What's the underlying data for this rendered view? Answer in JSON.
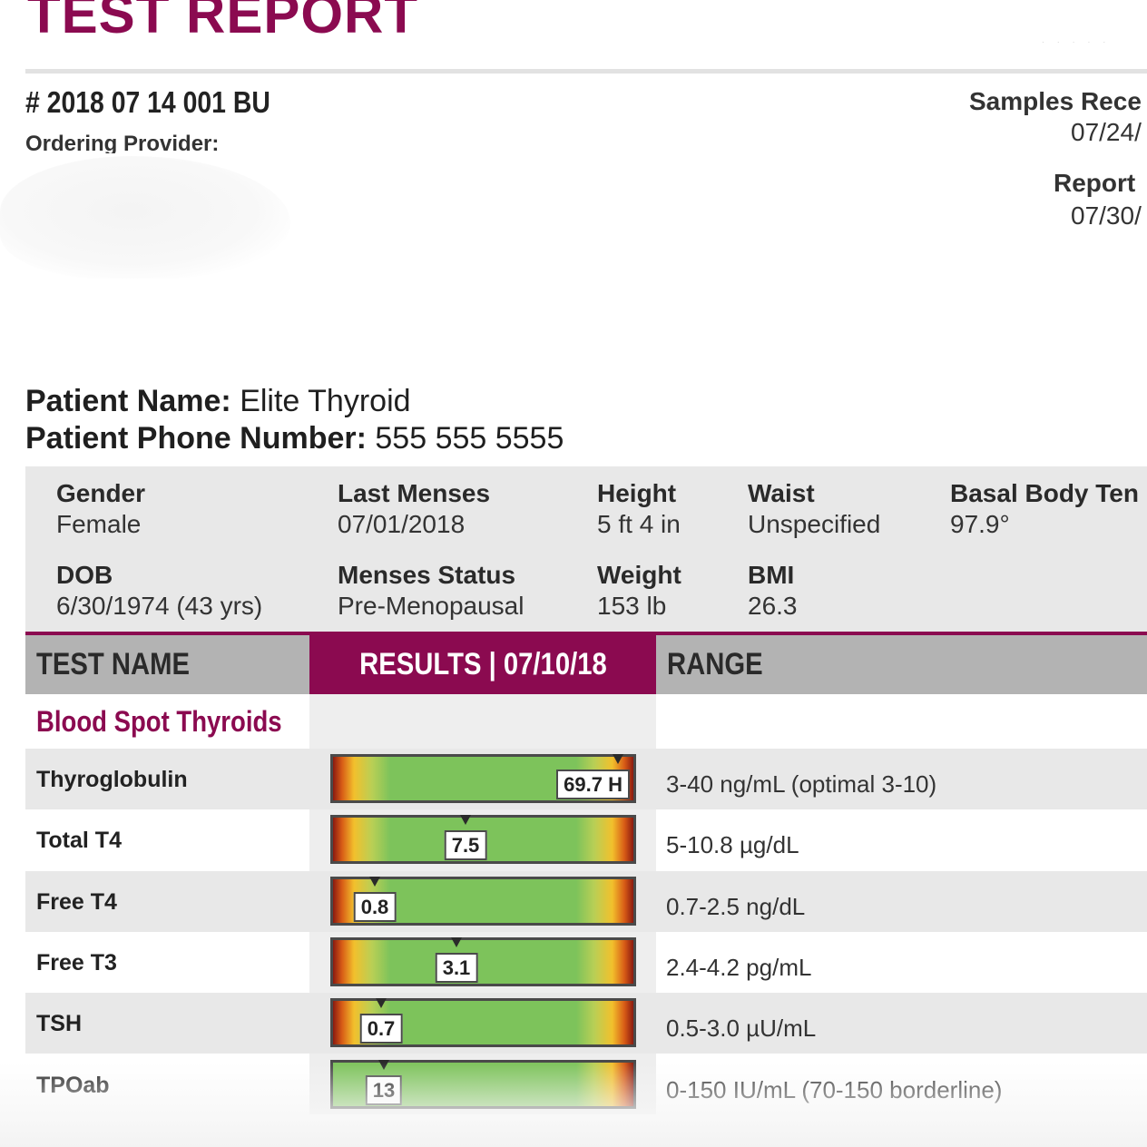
{
  "report": {
    "title": "TEST REPORT",
    "number": "# 2018 07 14 001 BU",
    "ordering_provider_label": "Ordering Provider:",
    "samples_received_label": "Samples Rece",
    "samples_received_value": "07/24/",
    "report_date_label": "Report",
    "report_date_value": "07/30/"
  },
  "patient": {
    "name_label": "Patient Name:",
    "name": "Elite Thyroid",
    "phone_label": "Patient Phone Number:",
    "phone": "555 555 5555"
  },
  "demographics": [
    {
      "label": "Gender",
      "value": "Female"
    },
    {
      "label": "Last Menses",
      "value": "07/01/2018"
    },
    {
      "label": "Height",
      "value": "5 ft 4 in"
    },
    {
      "label": "Waist",
      "value": "Unspecified"
    },
    {
      "label": "Basal Body Ten",
      "value": "97.9°"
    },
    {
      "label": "DOB",
      "value": "6/30/1974 (43 yrs)"
    },
    {
      "label": "Menses Status",
      "value": "Pre-Menopausal"
    },
    {
      "label": "Weight",
      "value": "153 lb"
    },
    {
      "label": "BMI",
      "value": "26.3"
    }
  ],
  "table": {
    "headers": {
      "name": "TEST NAME",
      "results": "RESULTS | 07/10/18",
      "range": "RANGE"
    },
    "section": "Blood Spot Thyroids",
    "rows": [
      {
        "name": "Thyroglobulin",
        "value": "69.7 H",
        "range": "3-40 ng/mL (optimal 3-10)",
        "marker_fraction": 0.95,
        "flag": "high"
      },
      {
        "name": "Total T4",
        "value": "7.5",
        "range": "5-10.8 µg/dL",
        "marker_fraction": 0.44,
        "flag": "normal"
      },
      {
        "name": "Free T4",
        "value": "0.8",
        "range": "0.7-2.5 ng/dL",
        "marker_fraction": 0.14,
        "flag": "normal"
      },
      {
        "name": "Free T3",
        "value": "3.1",
        "range": "2.4-4.2 pg/mL",
        "marker_fraction": 0.41,
        "flag": "normal"
      },
      {
        "name": "TSH",
        "value": "0.7",
        "range": "0.5-3.0 µU/mL",
        "marker_fraction": 0.16,
        "flag": "normal"
      },
      {
        "name": "TPOab",
        "value": "13",
        "range": "0-150 IU/mL (70-150 borderline)",
        "marker_fraction": 0.17,
        "flag": "normal"
      }
    ]
  },
  "colors": {
    "brand": "#8b0a50",
    "header_gray": "#b3b3b3",
    "row_alt": "#e8e8e8",
    "in_range": "#7dc35b",
    "out_of_range": "#8a1a10"
  }
}
